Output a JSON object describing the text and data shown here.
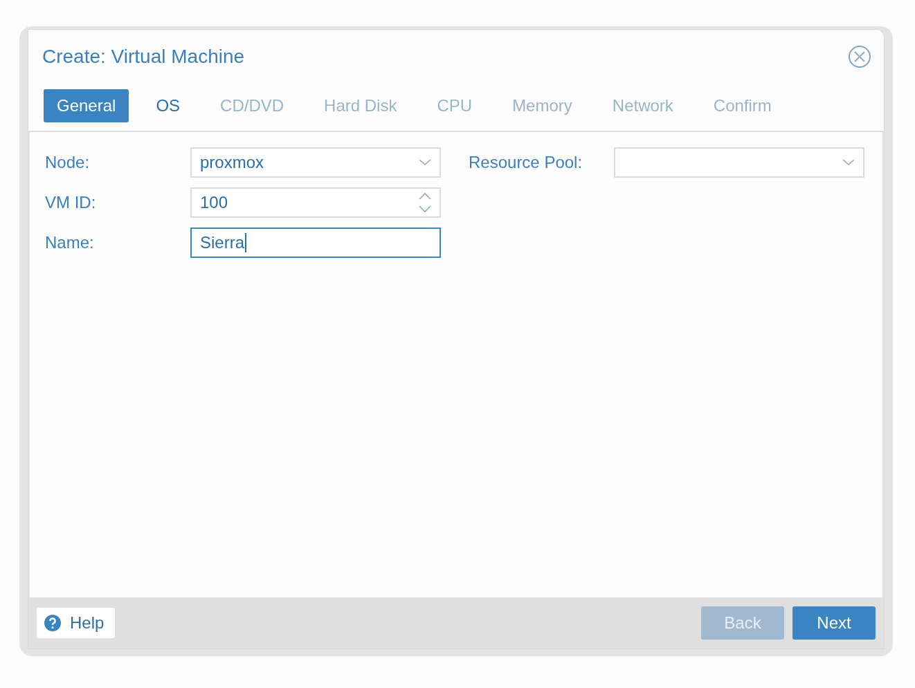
{
  "window": {
    "title": "Create: Virtual Machine"
  },
  "tabs": [
    {
      "label": "General",
      "selected": true,
      "disabled": false
    },
    {
      "label": "OS",
      "selected": false,
      "disabled": false
    },
    {
      "label": "CD/DVD",
      "selected": false,
      "disabled": true
    },
    {
      "label": "Hard Disk",
      "selected": false,
      "disabled": true
    },
    {
      "label": "CPU",
      "selected": false,
      "disabled": true
    },
    {
      "label": "Memory",
      "selected": false,
      "disabled": true
    },
    {
      "label": "Network",
      "selected": false,
      "disabled": true
    },
    {
      "label": "Confirm",
      "selected": false,
      "disabled": true
    }
  ],
  "left_fields": [
    {
      "label": "Node:",
      "kind": "combo",
      "value": "proxmox",
      "focused": false
    },
    {
      "label": "VM ID:",
      "kind": "number",
      "value": "100",
      "focused": false
    },
    {
      "label": "Name:",
      "kind": "text",
      "value": "Sierra",
      "focused": true
    }
  ],
  "right_fields": [
    {
      "label": "Resource Pool:",
      "kind": "combo",
      "focused": false
    }
  ],
  "footer": {
    "help": "Help",
    "buttons": [
      {
        "label": "Back",
        "disabled": true
      },
      {
        "label": "Next",
        "disabled": false
      }
    ]
  }
}
